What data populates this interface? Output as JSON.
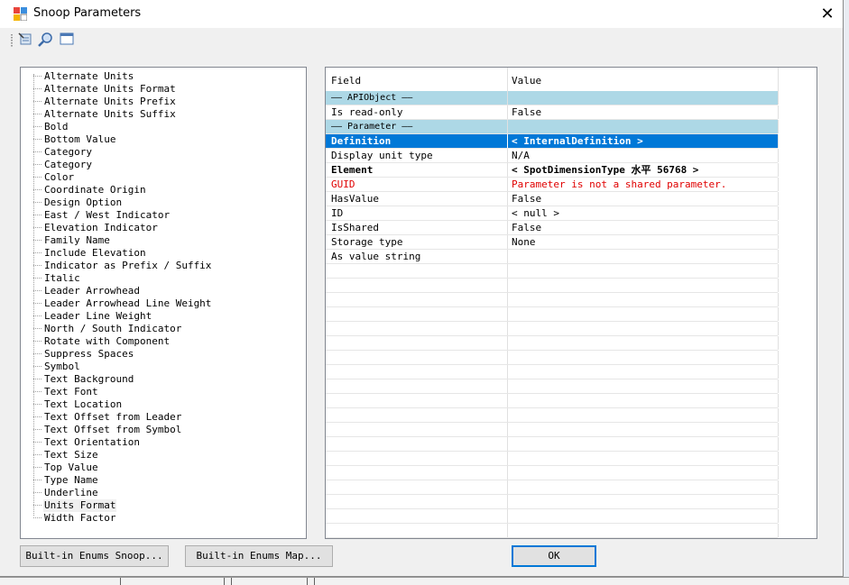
{
  "window": {
    "title": "Snoop Parameters",
    "close_glyph": "✕"
  },
  "toolbar": {
    "buttons": [
      "snoop-icon",
      "search-icon",
      "window-icon"
    ]
  },
  "tree": {
    "items": [
      "Alternate Units",
      "Alternate Units Format",
      "Alternate Units Prefix",
      "Alternate Units Suffix",
      "Bold",
      "Bottom Value",
      "Category",
      "Category",
      "Color",
      "Coordinate Origin",
      "Design Option",
      "East / West Indicator",
      "Elevation Indicator",
      "Family Name",
      "Include Elevation",
      "Indicator as Prefix / Suffix",
      "Italic",
      "Leader Arrowhead",
      "Leader Arrowhead Line Weight",
      "Leader Line Weight",
      "North / South Indicator",
      "Rotate with Component",
      "Suppress Spaces",
      "Symbol",
      "Text Background",
      "Text Font",
      "Text Location",
      "Text Offset from Leader",
      "Text Offset from Symbol",
      "Text Orientation",
      "Text Size",
      "Top Value",
      "Type Name",
      "Underline",
      "Units Format",
      "Width Factor"
    ],
    "selected": "Units Format"
  },
  "grid": {
    "header": {
      "field": "Field",
      "value": "Value"
    },
    "rows": [
      {
        "field": "—— APIObject ——",
        "value": "",
        "kind": "group"
      },
      {
        "field": "Is read-only",
        "value": "False",
        "kind": "normal"
      },
      {
        "field": "—— Parameter ——",
        "value": "",
        "kind": "group"
      },
      {
        "field": "Definition",
        "value": "< InternalDefinition >",
        "kind": "selected"
      },
      {
        "field": "Display unit type",
        "value": "N/A",
        "kind": "normal"
      },
      {
        "field": "Element",
        "value": "< SpotDimensionType  水平  56768 >",
        "kind": "bold"
      },
      {
        "field": "GUID",
        "value": "Parameter is not a shared parameter.",
        "kind": "red"
      },
      {
        "field": "HasValue",
        "value": "False",
        "kind": "normal"
      },
      {
        "field": "ID",
        "value": "< null >",
        "kind": "normal"
      },
      {
        "field": "IsShared",
        "value": "False",
        "kind": "normal"
      },
      {
        "field": "Storage type",
        "value": "None",
        "kind": "normal"
      },
      {
        "field": "As value string",
        "value": "",
        "kind": "normal"
      }
    ],
    "colors": {
      "group": "#add8e6",
      "selected": "#0078d7",
      "error": "#e00000"
    }
  },
  "buttons": {
    "enums_snoop": "Built-in Enums Snoop...",
    "enums_map": "Built-in Enums Map...",
    "ok": "OK"
  }
}
